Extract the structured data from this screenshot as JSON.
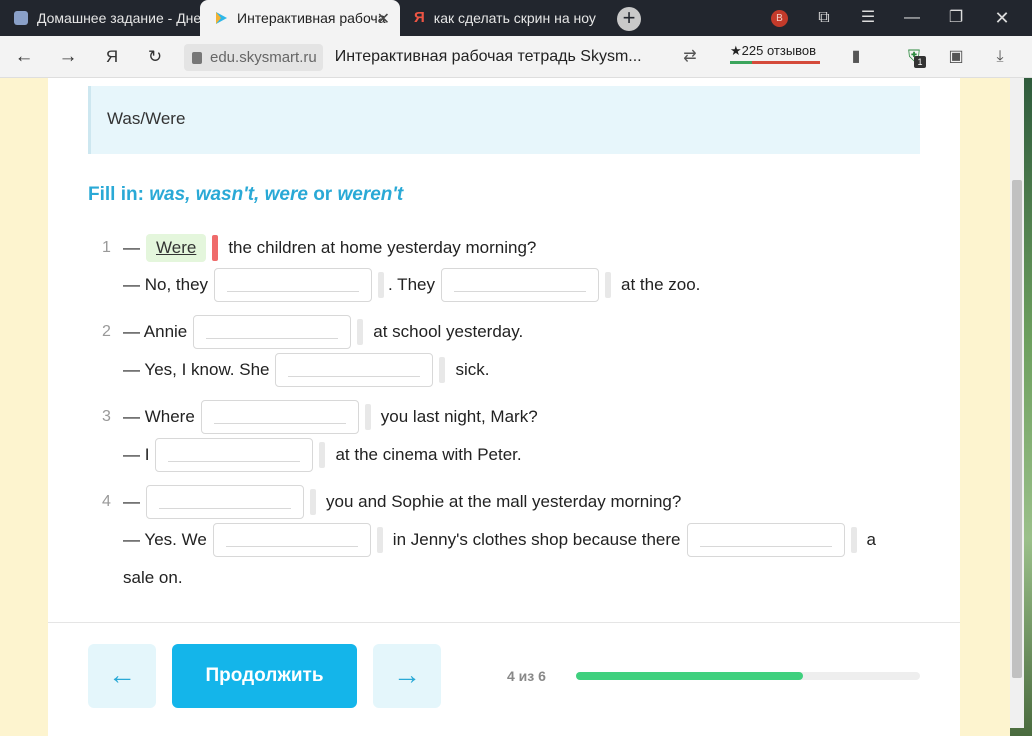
{
  "browser": {
    "tabs": [
      {
        "title": "Домашнее задание - Дне"
      },
      {
        "title": "Интерактивная рабоча"
      },
      {
        "title": "как сделать скрин на ноу"
      }
    ],
    "profile_badge": "B",
    "domain": "edu.skysmart.ru",
    "page_title": "Интерактивная рабочая тетрадь Skysm...",
    "reviews": "★225 отзывов",
    "ext_badge": "1"
  },
  "exercise": {
    "topic": "Was/Were",
    "instruction": {
      "prefix": "Fill in: ",
      "word1": "was, wasn't, were",
      "middle": " or ",
      "word2": "weren't"
    },
    "items": [
      {
        "num": "1",
        "line1": {
          "a": "—",
          "answer": "Were",
          "b": "the children at home yesterday morning?"
        },
        "line2": {
          "a": "— No, they",
          "b": ". They",
          "c": "at the zoo."
        }
      },
      {
        "num": "2",
        "line1": {
          "a": "— Annie",
          "b": "at school yesterday."
        },
        "line2": {
          "a": "— Yes, I know. She",
          "b": "sick."
        }
      },
      {
        "num": "3",
        "line1": {
          "a": "— Where",
          "b": "you last night, Mark?"
        },
        "line2": {
          "a": "— I",
          "b": "at the cinema with Peter."
        }
      },
      {
        "num": "4",
        "line1": {
          "a": "—",
          "b": "you and Sophie at the mall yesterday morning?"
        },
        "line2": {
          "a": "— Yes. We",
          "b": "in Jenny's clothes shop because there",
          "c": "a"
        },
        "line3": "sale on."
      }
    ]
  },
  "footer": {
    "prev_arrow": "←",
    "continue_label": "Продолжить",
    "next_arrow": "→",
    "progress_text": "4 из 6",
    "progress_fraction": 0.66
  }
}
